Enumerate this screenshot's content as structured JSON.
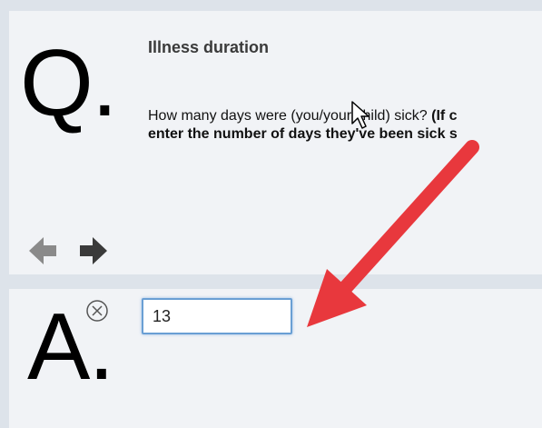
{
  "question": {
    "letter": "Q.",
    "title": "Illness duration",
    "line1_normal": "How many days were (you/your child) sick? ",
    "line1_bold": "(If c",
    "line2_bold": "enter the number of days they've been sick s"
  },
  "answer": {
    "letter": "A.",
    "value": "13"
  },
  "icons": {
    "back": "arrow-left-icon",
    "forward": "arrow-right-icon",
    "clear": "circle-x-icon",
    "cursor": "mouse-pointer-icon"
  },
  "colors": {
    "annotation_arrow": "#e8383d",
    "input_border": "#6a9fd4",
    "panel_bg": "#f1f3f6"
  }
}
